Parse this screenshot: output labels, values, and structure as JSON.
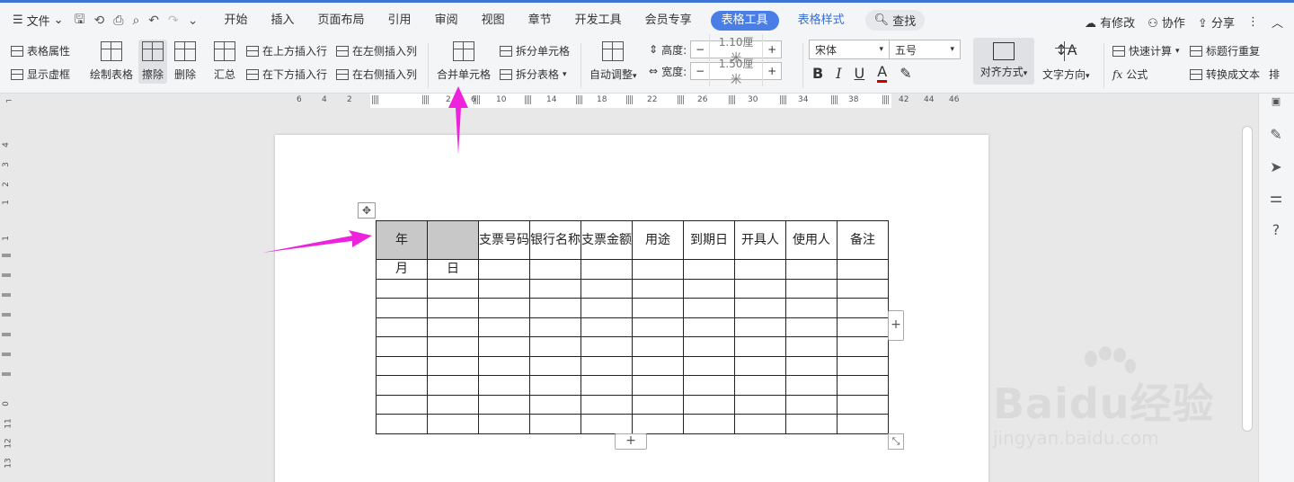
{
  "menubar": {
    "file_label": "文件",
    "tabs": [
      "开始",
      "插入",
      "页面布局",
      "引用",
      "审阅",
      "视图",
      "章节",
      "开发工具",
      "会员专享"
    ],
    "table_tools": "表格工具",
    "table_style": "表格样式",
    "search_label": "查找",
    "modified": "有修改",
    "collab": "协作",
    "share": "分享"
  },
  "ribbon": {
    "table_props": "表格属性",
    "show_grid": "显示虚框",
    "draw_table": "绘制表格",
    "erase": "擦除",
    "delete": "删除",
    "summary": "汇总",
    "insert_above": "在上方插入行",
    "insert_below": "在下方插入行",
    "insert_left": "在左侧插入列",
    "insert_right": "在右侧插入列",
    "merge_cells": "合并单元格",
    "split_cells": "拆分单元格",
    "split_table": "拆分表格",
    "auto_adjust": "自动调整",
    "height_label": "高度:",
    "height_value": "1.10厘米",
    "width_label": "宽度:",
    "width_value": "1.50厘米",
    "font_name": "宋体",
    "font_size": "五号",
    "align": "对齐方式",
    "text_dir": "文字方向",
    "quick_calc": "快速计算",
    "formula": "公式",
    "repeat_header": "标题行重复",
    "to_text": "转换成文本",
    "sort": "排"
  },
  "ruler": {
    "numbers": [
      "6",
      "4",
      "2",
      "2",
      "6",
      "10",
      "14",
      "18",
      "22",
      "26",
      "30",
      "34",
      "38",
      "42",
      "44",
      "46"
    ]
  },
  "vruler": {
    "numbers": [
      "4",
      "3",
      "2",
      "1",
      "1",
      "0",
      "11",
      "12",
      "13"
    ]
  },
  "table": {
    "header": [
      "年",
      "",
      "支票号码",
      "银行名称",
      "支票金额",
      "用途",
      "到期日",
      "开具人",
      "使用人",
      "备注"
    ],
    "row2": [
      "月",
      "日",
      "",
      "",
      "",
      "",
      "",
      "",
      "",
      ""
    ],
    "empty_rows": 8
  },
  "watermark": {
    "brand": "Baidu经验",
    "url": "jingyan.baidu.com"
  },
  "colors": {
    "accent": "#4a7ee6",
    "arrow": "#ee22dd",
    "header_gray": "#c8c8c8"
  }
}
